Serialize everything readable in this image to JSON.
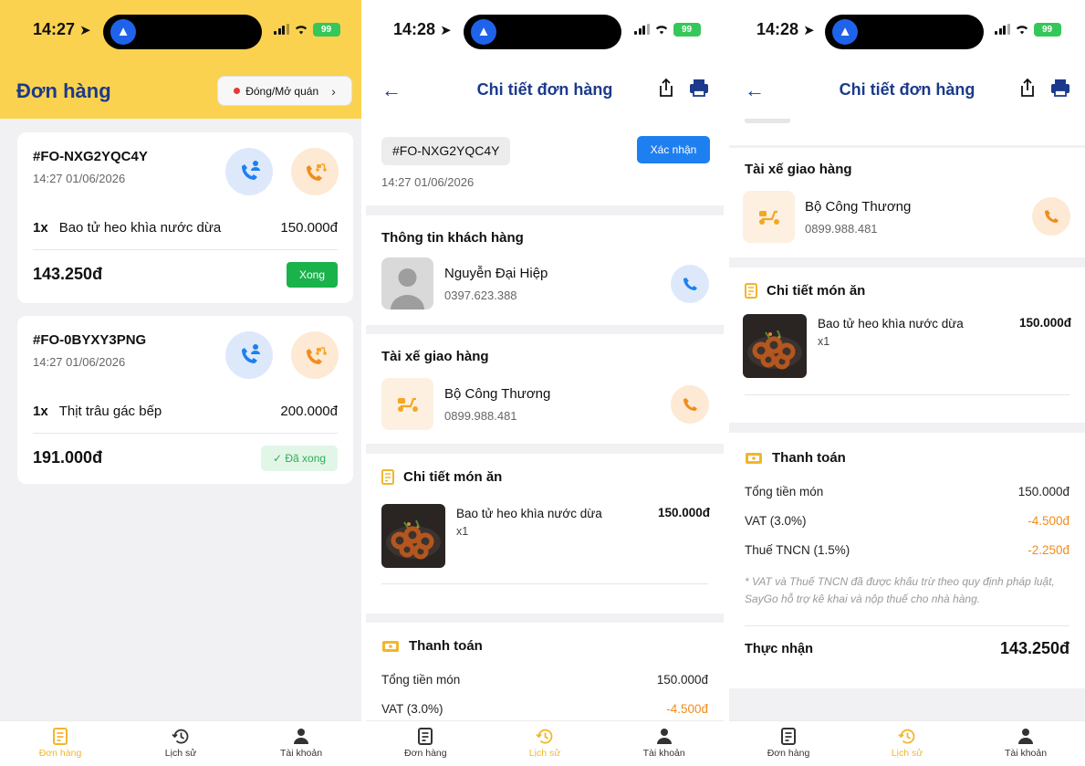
{
  "status_bar": {
    "s1_time": "14:27",
    "s2_time": "14:28",
    "s3_time": "14:28",
    "battery": "99"
  },
  "orders_screen": {
    "title": "Đơn hàng",
    "toggle_label": "Đóng/Mở quán",
    "orders": [
      {
        "id": "#FO-NXG2YQC4Y",
        "datetime": "14:27 01/06/2026",
        "qty": "1x",
        "item": "Bao tử heo khìa nước dừa",
        "price": "150.000đ",
        "total": "143.250đ",
        "action": "Xong"
      },
      {
        "id": "#FO-0BYXY3PNG",
        "datetime": "14:27 01/06/2026",
        "qty": "1x",
        "item": "Thịt trâu gác bếp",
        "price": "200.000đ",
        "total": "191.000đ",
        "status": "✓ Đã xong"
      }
    ]
  },
  "detail": {
    "title": "Chi tiết đơn hàng",
    "order_id": "#FO-NXG2YQC4Y",
    "datetime": "14:27 01/06/2026",
    "confirm_label": "Xác nhận",
    "customer_section": "Thông tin khách hàng",
    "customer_name": "Nguyễn Đại Hiệp",
    "customer_phone": "0397.623.388",
    "driver_section": "Tài xế giao hàng",
    "driver_name": "Bộ Công Thương",
    "driver_phone": "0899.988.481",
    "food_section": "Chi tiết món ăn",
    "food_name": "Bao tử heo khìa nước dừa",
    "food_qty": "x1",
    "food_price": "150.000đ",
    "payment_section": "Thanh toán",
    "subtotal_label": "Tổng tiền món",
    "subtotal_value": "150.000đ",
    "vat_label": "VAT (3.0%)",
    "vat_value": "-4.500đ",
    "pit_label": "Thuế TNCN (1.5%)",
    "pit_value": "-2.250đ",
    "tax_note": "* VAT và Thuế TNCN đã được khấu trừ theo quy định pháp luật, SayGo hỗ trợ kê khai và nộp thuế cho nhà hàng.",
    "net_label": "Thực nhận",
    "net_value": "143.250đ"
  },
  "tabs": {
    "orders": "Đơn hàng",
    "history": "Lịch sử",
    "account": "Tài khoản"
  },
  "colors": {
    "brand_yellow": "#fad24f",
    "title_blue": "#1b3a8c",
    "confirm_blue": "#1e7ff0",
    "done_green": "#19b24b",
    "negative_orange": "#f08c1c",
    "active_tab": "#f2b62b"
  }
}
